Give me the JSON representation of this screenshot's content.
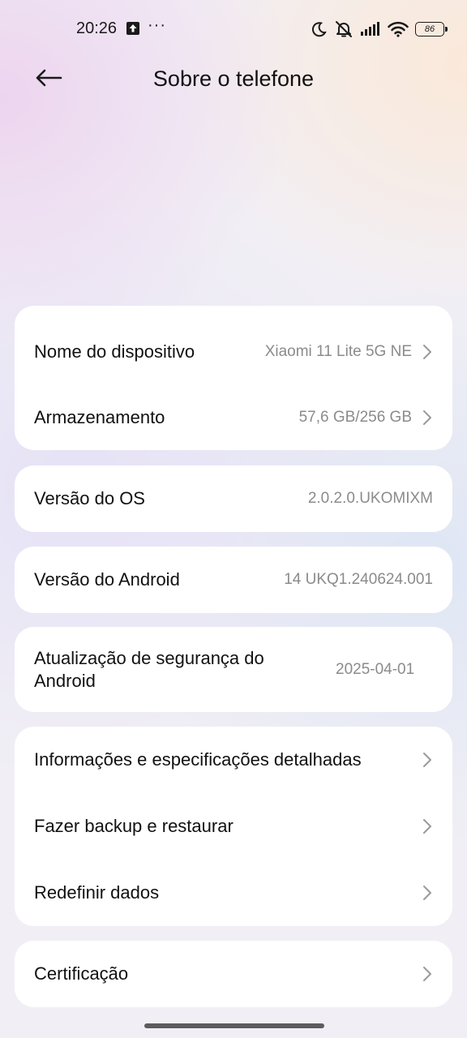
{
  "status_bar": {
    "time": "20:26",
    "upload_icon": "upload-notification-icon",
    "more_icon": "more-notifications-icon",
    "more_text": "···",
    "icons": [
      "moon-icon",
      "muted-bell-icon",
      "signal-icon",
      "wifi-icon"
    ],
    "battery": "86"
  },
  "header": {
    "back_icon": "arrow-left-icon",
    "title": "Sobre o telefone"
  },
  "cards": {
    "device": {
      "name_label": "Nome do dispositivo",
      "name_value": "Xiaomi 11 Lite 5G NE",
      "storage_label": "Armazenamento",
      "storage_value": "57,6 GB/256 GB"
    },
    "os": {
      "label": "Versão do OS",
      "value": "2.0.2.0.UKOMIXM"
    },
    "android": {
      "label": "Versão do Android",
      "value": "14 UKQ1.240624.001"
    },
    "security": {
      "label": "Atualização de segurança do Android",
      "value": "2025-04-01"
    },
    "more": {
      "specs_label": "Informações e especificações detalhadas",
      "backup_label": "Fazer backup e restaurar",
      "reset_label": "Redefinir dados"
    },
    "cert": {
      "label": "Certificação"
    }
  },
  "colors": {
    "card_bg": "#ffffff",
    "value_text": "#8b8b8b",
    "chevron": "#9a9a9a"
  }
}
